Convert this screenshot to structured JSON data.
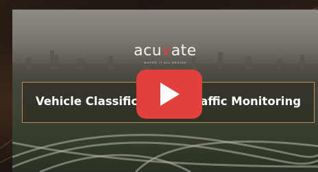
{
  "video": {
    "brand_logo_before": "acu",
    "brand_logo_accent": "v",
    "brand_logo_after": "ate",
    "brand_tagline": "WHERE IT ALL BEGINS",
    "title": "Vehicle Classification & Traffic Monitoring",
    "play_button_label": "Play video",
    "play_icon": "play-icon"
  },
  "colors": {
    "play_button": "#e2403c",
    "title_border": "#d6a060",
    "logo_accent": "#e2403c"
  }
}
